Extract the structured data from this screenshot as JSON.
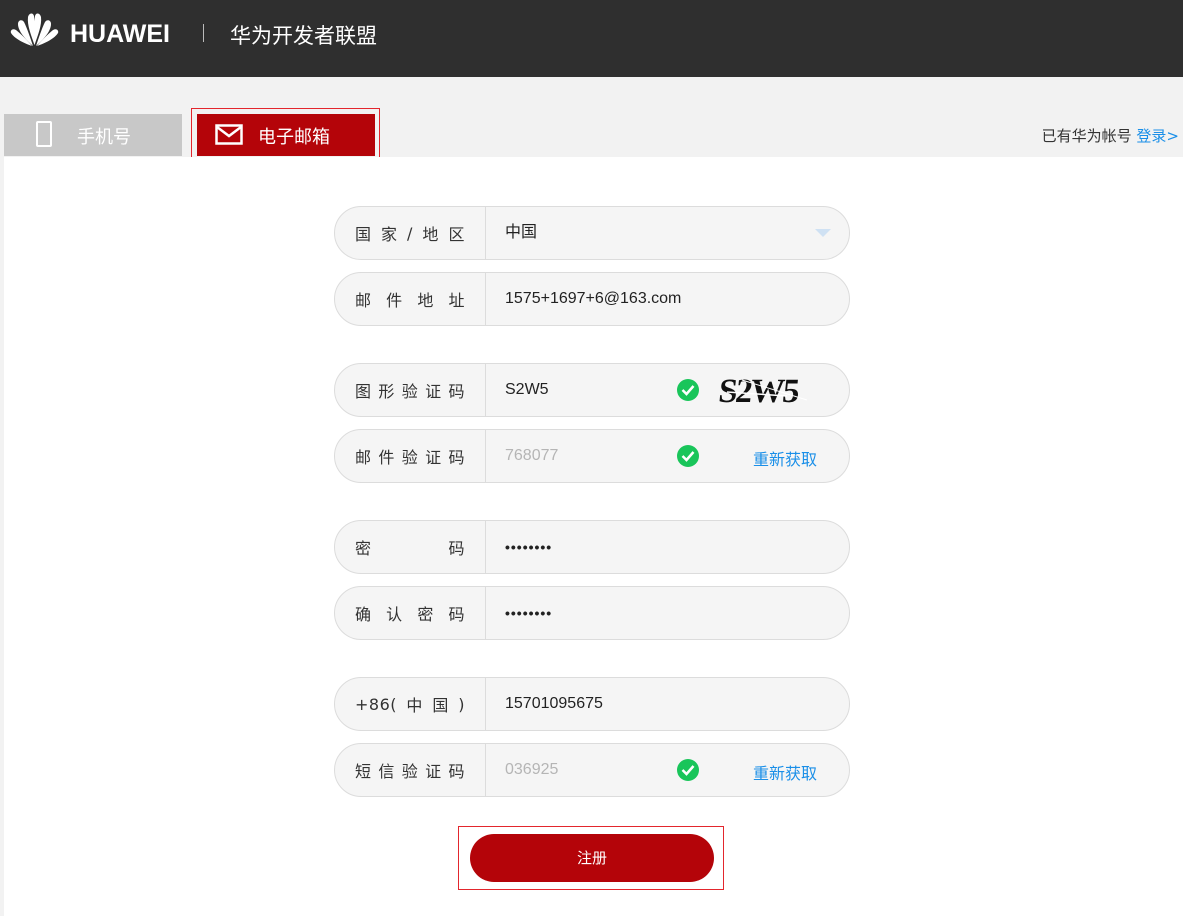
{
  "header": {
    "brand": "HUAWEI",
    "divider": "|",
    "site_title": "华为开发者联盟",
    "logo_icon": "huawei-flower-logo"
  },
  "tabs": {
    "phone": {
      "label": "手机号",
      "icon": "mobile-phone-icon",
      "selected": false
    },
    "email": {
      "label": "电子邮箱",
      "icon": "envelope-icon",
      "selected": true
    }
  },
  "login_hint": {
    "text": "已有华为帐号",
    "link": "登录>"
  },
  "form": {
    "country": {
      "label_chars": [
        "国",
        "家",
        "/",
        "地",
        "区"
      ],
      "value": "中国"
    },
    "email": {
      "label_chars": [
        "邮",
        "件",
        "地",
        "址"
      ],
      "value": "1575+1697+6@163.com"
    },
    "captcha": {
      "label_chars": [
        "图",
        "形",
        "验",
        "证",
        "码"
      ],
      "value": "S2W5",
      "image_text": "S2W5"
    },
    "email_code": {
      "label_chars": [
        "邮",
        "件",
        "验",
        "证",
        "码"
      ],
      "value": "768077",
      "action": "重新获取"
    },
    "password": {
      "label_chars": [
        "密",
        "码"
      ],
      "value": "••••••••"
    },
    "confirm_password": {
      "label_chars": [
        "确",
        "认",
        "密",
        "码"
      ],
      "value": "••••••••"
    },
    "phone": {
      "label_chars": [
        "+86(",
        "中",
        "国",
        ")"
      ],
      "value": "15701095675"
    },
    "sms_code": {
      "label_chars": [
        "短",
        "信",
        "验",
        "证",
        "码"
      ],
      "value": "036925",
      "action": "重新获取"
    }
  },
  "submit": {
    "label": "注册"
  },
  "colors": {
    "brand_red": "#b40409",
    "link_blue": "#1a8fe8",
    "success_green": "#19c55a",
    "topbar": "#2f2f2f"
  }
}
